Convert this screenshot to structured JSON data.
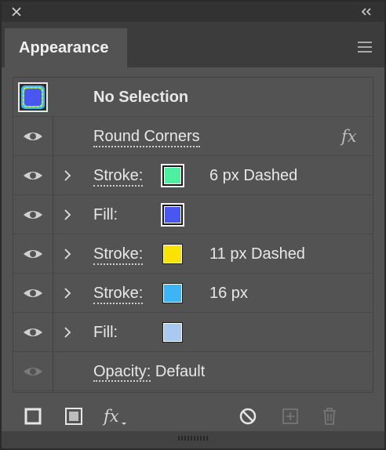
{
  "panel": {
    "tab_title": "Appearance"
  },
  "rows": {
    "no_selection": {
      "label": "No Selection"
    },
    "round_corners": {
      "label": "Round Corners"
    },
    "stroke1": {
      "label": "Stroke:",
      "color": "#4ef0a0",
      "value": "6 px Dashed"
    },
    "fill1": {
      "label": "Fill:",
      "color": "#4a56f0"
    },
    "stroke2": {
      "label": "Stroke:",
      "color": "#f8e400",
      "value": "11 px Dashed"
    },
    "stroke3": {
      "label": "Stroke:",
      "color": "#3cb4f5",
      "value": "16 px"
    },
    "fill2": {
      "label": "Fill:",
      "color": "#aac9f0"
    },
    "opacity": {
      "label": "Opacity:",
      "value": "Default"
    }
  },
  "icons": {
    "close": "close-icon",
    "collapse": "double-chevron-left-icon",
    "menu": "hamburger-menu-icon",
    "eye": "eye-icon",
    "chevron": "chevron-right-icon",
    "fx": "fx-icon",
    "add_stroke": "add-stroke-icon",
    "add_fill": "add-fill-icon",
    "add_effect": "add-effect-icon",
    "clear": "clear-appearance-icon",
    "duplicate": "duplicate-item-icon",
    "delete": "trash-icon"
  },
  "colors": {
    "panel_bg": "#535353",
    "titlebar_bg": "#323232"
  }
}
